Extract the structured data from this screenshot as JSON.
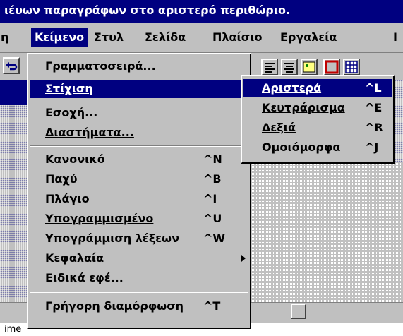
{
  "title": "ιέυων παραγράφων στο αριστερό περιθώριο.",
  "menubar": {
    "items": [
      {
        "label": "η"
      },
      {
        "label": "Κείμενο"
      },
      {
        "label": "Στυλ"
      },
      {
        "label": "Σελίδα"
      },
      {
        "label": "Πλαίσιο"
      },
      {
        "label": "Εργαλεία"
      },
      {
        "label": "Ι"
      }
    ]
  },
  "keimeno_menu": {
    "items": [
      {
        "label": "Γραμματοσειρά...",
        "shortcut": ""
      },
      {
        "label": "Στίχιση",
        "shortcut": ""
      },
      {
        "label": "Εσοχή...",
        "shortcut": ""
      },
      {
        "label": "Διαστήματα...",
        "shortcut": ""
      },
      {
        "label": "Κανονικό",
        "shortcut": "^N"
      },
      {
        "label": "Παχύ",
        "shortcut": "^B"
      },
      {
        "label": "Πλάγιο",
        "shortcut": "^I"
      },
      {
        "label": "Υπογραμμισμένο",
        "shortcut": "^U"
      },
      {
        "label": "Υπογράμμιση λέξεων",
        "shortcut": "^W"
      },
      {
        "label": "Κεφαλαία",
        "shortcut": ""
      },
      {
        "label": "Ειδικά εφέ...",
        "shortcut": ""
      },
      {
        "label": "Γρήγορη διαμόρφωση",
        "shortcut": "^T"
      }
    ]
  },
  "alignment_submenu": {
    "items": [
      {
        "label": "Αριστερά",
        "shortcut": "^L"
      },
      {
        "label": "Κευτράρισμα",
        "shortcut": "^E"
      },
      {
        "label": "Δεξιά",
        "shortcut": "^R"
      },
      {
        "label": "Ομοιόμορφα",
        "shortcut": "^J"
      }
    ]
  },
  "statusbar": {
    "text": "ime"
  },
  "colors": {
    "highlight": "#000080",
    "face": "#c0c0c0"
  },
  "icons": [
    "undo-icon",
    "align-left-icon",
    "align-center-icon",
    "image-icon",
    "frame-icon",
    "table-icon"
  ]
}
